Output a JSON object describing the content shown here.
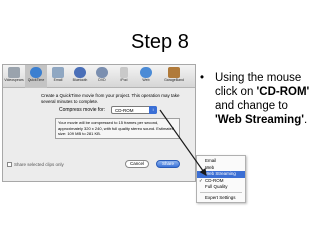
{
  "slide": {
    "title": "Step 8"
  },
  "bullet": {
    "prefix": "Using the mouse click on ",
    "bold1": "'CD-ROM'",
    "middle": " and change to ",
    "bold2": "'Web Streaming'",
    "suffix": "."
  },
  "dialog": {
    "toolbar": [
      {
        "label": "Videospears",
        "icon": "film-icon",
        "color": "#9aa3ad"
      },
      {
        "label": "QuickTime",
        "icon": "quicktime-icon",
        "color": "#3b7fd0"
      },
      {
        "label": "Email",
        "icon": "email-icon",
        "color": "#8fa7c2"
      },
      {
        "label": "Bluetooth",
        "icon": "bluetooth-icon",
        "color": "#4a6fb8"
      },
      {
        "label": "DVD",
        "icon": "dvd-icon",
        "color": "#7b8fb0"
      },
      {
        "label": "iPod",
        "icon": "ipod-icon",
        "color": "#c9c9c9"
      },
      {
        "label": "Web",
        "icon": "web-icon",
        "color": "#4b8bd6"
      },
      {
        "label": "GarageBand",
        "icon": "guitar-icon",
        "color": "#b07a3a"
      }
    ],
    "description": "Create a QuickTime movie from your project. This operation may take several minutes to complete.",
    "compress_label": "Compress movie for:",
    "compress_value": "CD-ROM",
    "info": "Your movie will be compressed to 15 frames per second, approximately 320 x 240, with full quality stereo sound. Estimated size: 109 MB to 281 KB.",
    "share_selected": "Share selected clips only",
    "cancel_label": "Cancel",
    "share_label": "Share"
  },
  "menu": {
    "items": [
      "Email",
      "Web",
      "Web Streaming",
      "CD-ROM",
      "Full Quality",
      "Expert Settings"
    ],
    "highlighted": "Web Streaming",
    "checked": "CD-ROM"
  },
  "colors": {
    "highlight": "#3c6fd4",
    "arrow": "#1a1a1a"
  }
}
